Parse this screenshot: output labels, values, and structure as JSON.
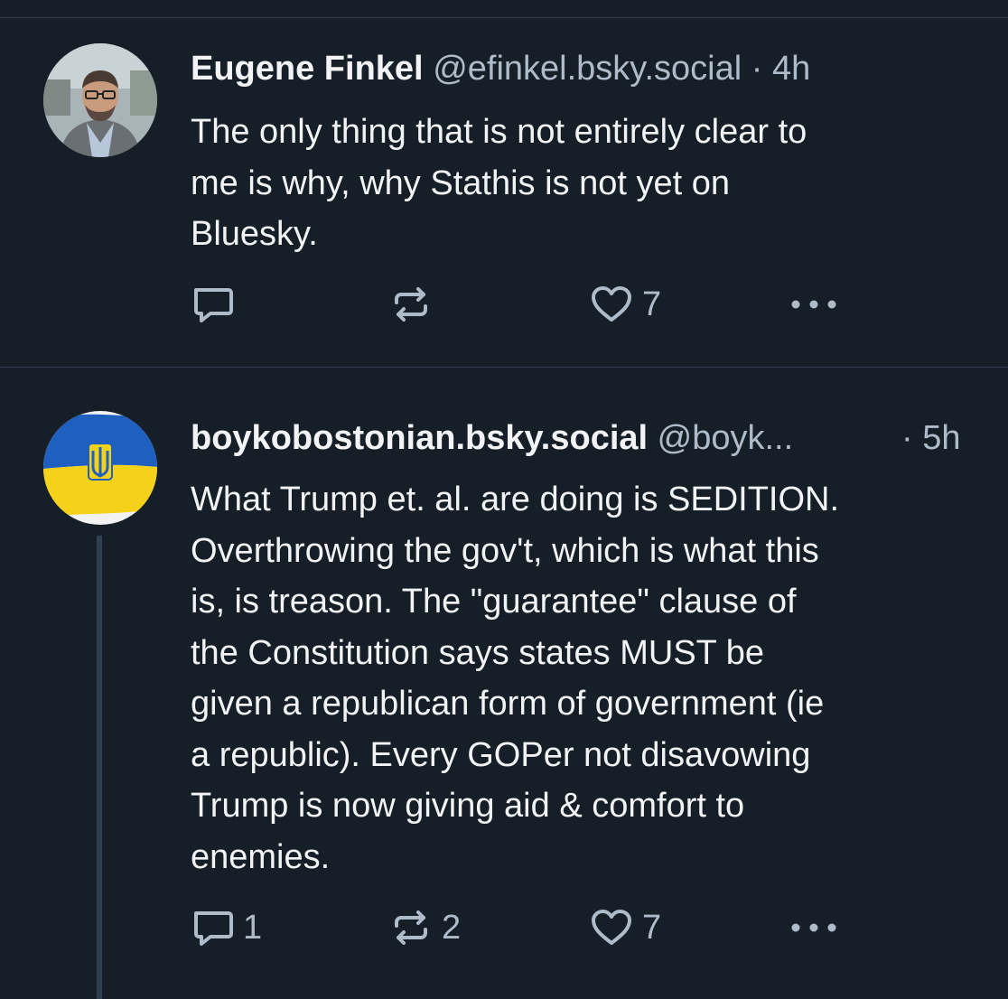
{
  "posts": [
    {
      "author_name": "Eugene Finkel",
      "handle": "@efinkel.bsky.social",
      "time": "· 4h",
      "text_lines": [
        "The only thing that is not entirely clear to",
        "me is why, why Stathis is not yet on",
        "Bluesky."
      ],
      "reply_count": "",
      "repost_count": "",
      "like_count": "7"
    },
    {
      "author_name": "boykobostonian.bsky.social",
      "handle": "@boyk...",
      "time": "· 5h",
      "text_lines": [
        "What Trump et. al. are doing is SEDITION.",
        "Overthrowing the gov't, which is what this",
        "is, is treason. The \"guarantee\" clause of",
        "the Constitution says states MUST be",
        "given a republican form of government (ie",
        "a republic). Every GOPer not disavowing",
        "Trump is now giving aid & comfort to",
        "enemies."
      ],
      "reply_count": "1",
      "repost_count": "2",
      "like_count": "7"
    }
  ],
  "icons": {
    "reply": "reply-icon",
    "repost": "repost-icon",
    "like": "heart-icon",
    "more": "more-icon"
  },
  "colors": {
    "background": "#161e27",
    "text": "#f1f3f5",
    "muted": "#aebbc9",
    "divider": "#2e4052"
  }
}
